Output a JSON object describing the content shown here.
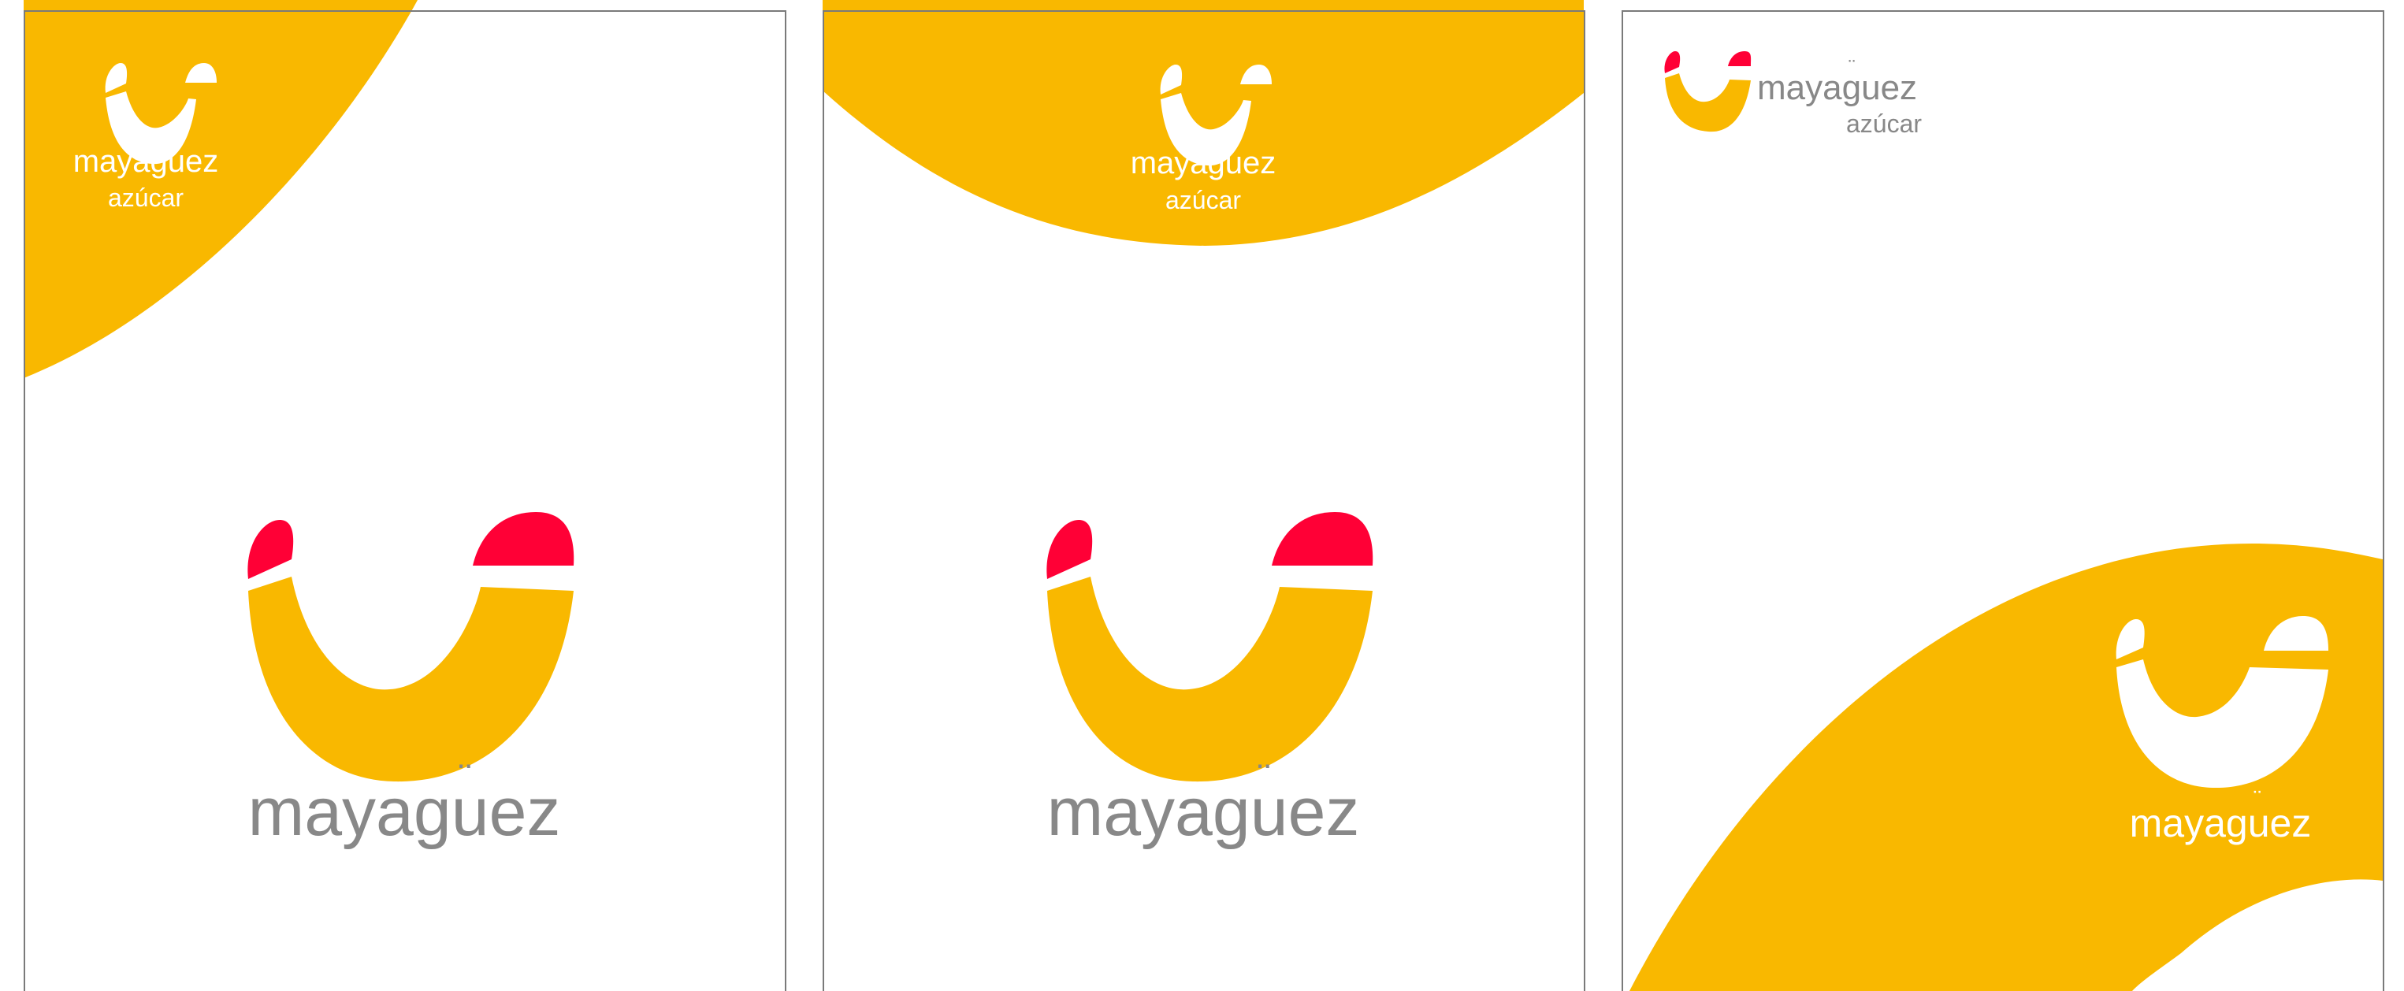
{
  "colors": {
    "yellow": "#F9B800",
    "red": "#FF0036",
    "gray": "#888888",
    "white": "#FFFFFF",
    "frame": "#7A7A7A"
  },
  "brand": {
    "wordmark_base": "mayag",
    "wordmark_umlaut_char": "u",
    "wordmark_end": "ez",
    "tagline": "azúcar"
  },
  "panels": [
    {
      "name": "panel-1",
      "logo_icon": "smile-logo-icon",
      "corner_arc": "top-left"
    },
    {
      "name": "panel-2",
      "logo_icon": "smile-logo-icon",
      "corner_arc": "top-banner"
    },
    {
      "name": "panel-3",
      "logo_icon": "smile-logo-icon",
      "corner_arc": "bottom-right"
    }
  ]
}
